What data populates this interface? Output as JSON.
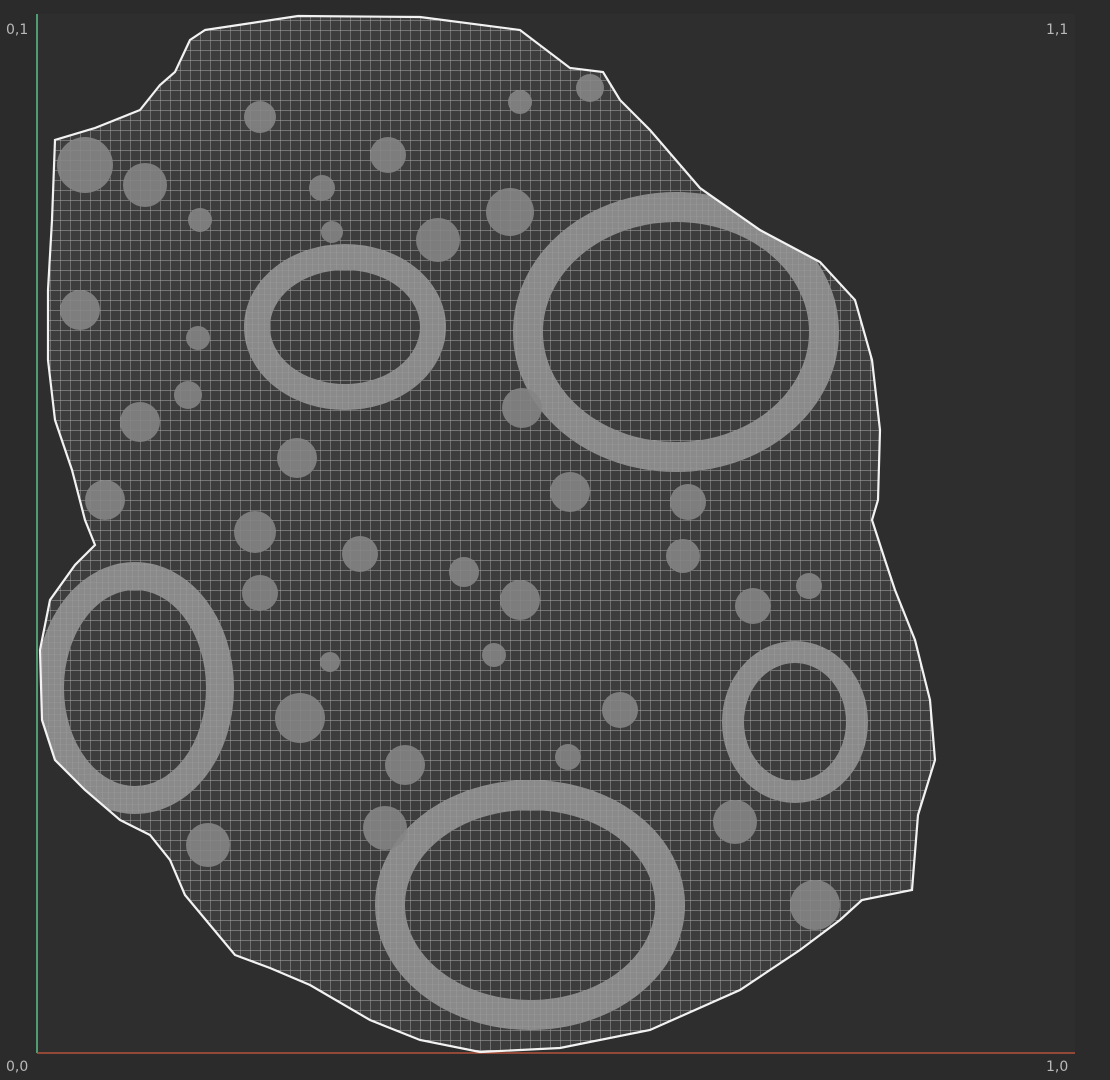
{
  "viewport": {
    "corner_labels": {
      "top_left": "0,1",
      "top_right": "1,1",
      "bottom_left": "0,0",
      "bottom_right": "1,0"
    },
    "colors": {
      "background": "#2b2b2b",
      "mesh_fill": "#3a3a3a",
      "mesh_wire": "#d8d8d8",
      "island_outline": "#f2f2f2",
      "dense_ring": "#8a8a8a",
      "u_axis": "#b4523a",
      "v_axis": "#5fbf8a",
      "label_text": "#b9b9b9"
    }
  }
}
